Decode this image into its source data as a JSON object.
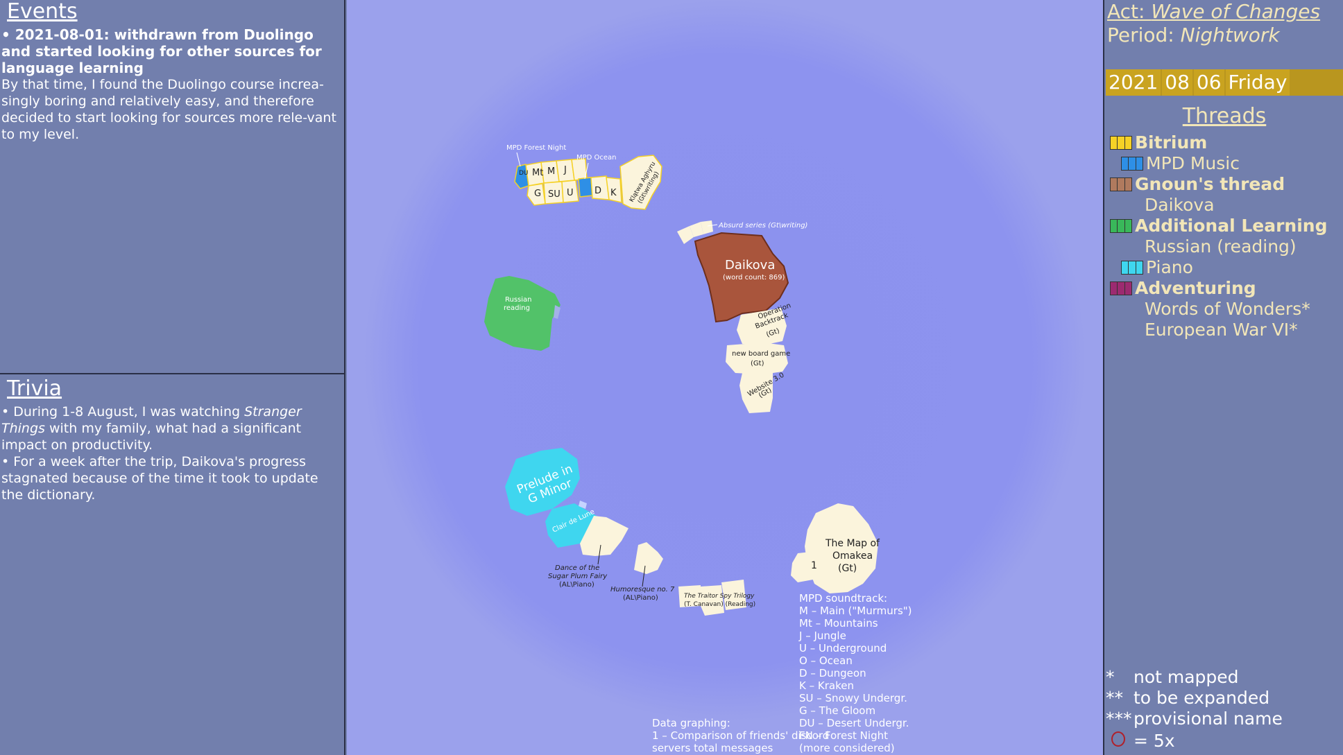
{
  "events": {
    "heading": "Events",
    "title": "• 2021-08-01: withdrawn from Duolingo and started looking for other sources for language learning",
    "body": "By that time, I found the Duolingo course increa-singly boring and relatively easy, and therefore decided to start looking for sources more rele-vant to my level."
  },
  "trivia": {
    "heading": "Trivia",
    "item1_pre": "• During 1-8 August, I was watching ",
    "item1_em": "Stranger Things",
    "item1_post": " with my family, what had a significant impact on productivity.",
    "item2": "• For a week after the trip, Daikova's progress stagnated because of the time it took to update the dictionary."
  },
  "header": {
    "act_label": "Act: ",
    "act_name": "Wave of Changes",
    "period_label": "Period: ",
    "period_name": "Nightwork",
    "date": {
      "year": "2021",
      "month": "08",
      "day": "06",
      "weekday": "Friday"
    }
  },
  "threads": {
    "heading": "Threads",
    "items": [
      {
        "label": "Bitrium",
        "colors": [
          "#f5d126",
          "#f5d126",
          "#f5d126"
        ]
      },
      {
        "label": "MPD Music",
        "colors": [
          "#2e8fe6",
          "#2e8fe6",
          "#2e8fe6"
        ]
      },
      {
        "label": "Gnoun's thread",
        "colors": [
          "#b07a5e",
          "#b07a5e",
          "#b07a5e"
        ]
      },
      {
        "label": "Daikova"
      },
      {
        "label": "Additional Learning",
        "colors": [
          "#39b85a",
          "#39b85a",
          "#39b85a"
        ]
      },
      {
        "label": "Russian (reading)"
      },
      {
        "label": "Piano",
        "colors": [
          "#3fd6ef",
          "#3fd6ef",
          "#3fd6ef"
        ]
      },
      {
        "label": "Adventuring",
        "colors": [
          "#9c2a70",
          "#9c2a70",
          "#9c2a70"
        ]
      },
      {
        "label": "Words of Wonders*"
      },
      {
        "label": "European War VI*"
      }
    ]
  },
  "legend": {
    "l1_sym": "*",
    "l1_text": "not mapped",
    "l2_sym": "**",
    "l2_text": "to be expanded",
    "l3_sym": "***",
    "l3_text": "provisional name",
    "l4_text": "= 5x"
  },
  "notes": {
    "soundtrack": "MPD soundtrack:\nM – Main (\"Murmurs\")\nMt – Mountains\nJ – Jungle\nU – Underground\nO – Ocean\nD – Dungeon\nK – Kraken\nSU – Snowy Undergr.\nG – The Gloom\nDU – Desert Undergr.\nFN – Forest Night\n(more considered)",
    "graphing": "Data graphing:\n1 – Comparison of friends' discord\nservers total messages"
  },
  "map_labels": {
    "mpd_forest": "MPD Forest Night",
    "mpd_ocean": "MPD Ocean",
    "du": "DU",
    "mt": "Mt",
    "m": "M",
    "j": "J",
    "g": "G",
    "su": "SU",
    "u": "U",
    "d": "D",
    "k": "K",
    "klatwa": "Klątwa Aghyru",
    "klatwa2": "(Gt\\writing)",
    "absurd": "Absurd series (Gt\\writing)",
    "daikova": "Daikova",
    "daikova_wc": "(word count: 869)",
    "op_back": "Operation",
    "op_back2": "Backtrack",
    "op_back3": "(Gt)",
    "board": "new board game",
    "board2": "(Gt)",
    "website": "Website 3.0",
    "website2": "(Gt)",
    "russian": "Russian",
    "russian2": "reading",
    "prelude": "Prelude in",
    "prelude2": "G Minor",
    "clair": "Clair de Lune",
    "sugar": "Dance of the",
    "sugar2": "Sugar Plum Fairy",
    "sugar3": "(AL\\Piano)",
    "humoresque": "Humoresque no. 7",
    "humoresque2": "(AL\\Piano)",
    "traitor": "The Traitor Spy Trilogy",
    "traitor2": "(T. Canavan) (Reading)",
    "omakea": "The Map of",
    "omakea2": "Omakea",
    "omakea3": "(Gt)",
    "one": "1"
  },
  "colors": {
    "bitrium": "#f5d126",
    "mpd": "#2e8fe6",
    "gnoun": "#b07a5e",
    "learning": "#39b85a",
    "piano": "#3fd6ef",
    "adventuring": "#9c2a70",
    "tile": "#fbf4dc",
    "daikova": "#a9553c"
  }
}
